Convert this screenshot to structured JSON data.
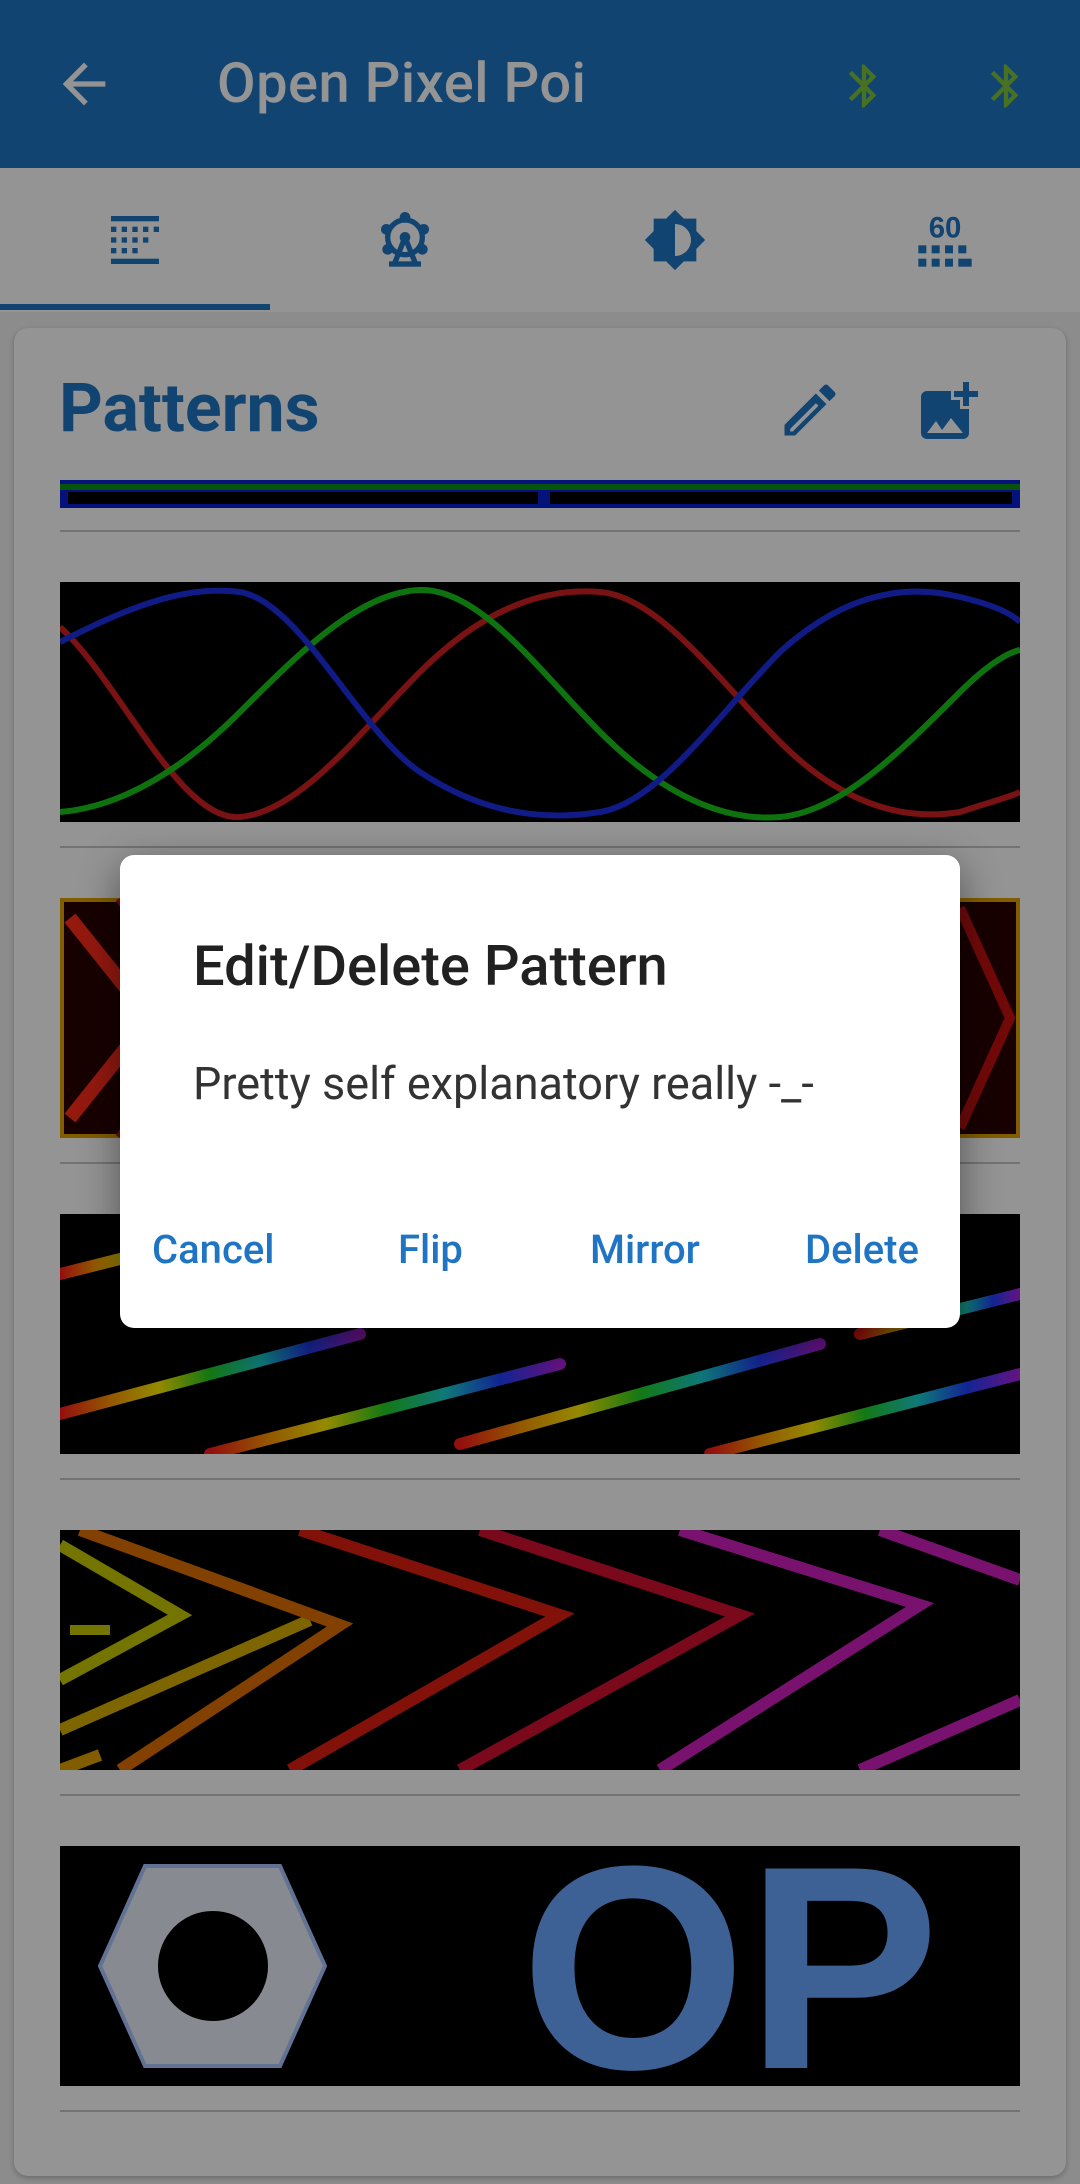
{
  "app_bar": {
    "title": "Open Pixel Poi",
    "back_icon": "arrow-back-icon",
    "bluetooth_icons": [
      "bluetooth-icon",
      "bluetooth-icon"
    ],
    "bluetooth_color": "#7cc33a"
  },
  "tabs": [
    {
      "icon": "pattern-grid-icon",
      "selected": true
    },
    {
      "icon": "ferris-wheel-icon",
      "selected": false
    },
    {
      "icon": "brightness-icon",
      "selected": false
    },
    {
      "icon": "speed-60-icon",
      "selected": false,
      "text": "60"
    }
  ],
  "patterns_card": {
    "heading": "Patterns",
    "edit_icon": "pencil-icon",
    "add_icon": "add-photo-icon"
  },
  "dialog": {
    "title": "Edit/Delete Pattern",
    "message": "Pretty self explanatory really -_-",
    "buttons": {
      "cancel": "Cancel",
      "flip": "Flip",
      "mirror": "Mirror",
      "delete": "Delete"
    }
  },
  "logo_text": "OP",
  "colors": {
    "primary": "#1f75c4",
    "scrim": "rgba(0,0,0,0.42)"
  }
}
